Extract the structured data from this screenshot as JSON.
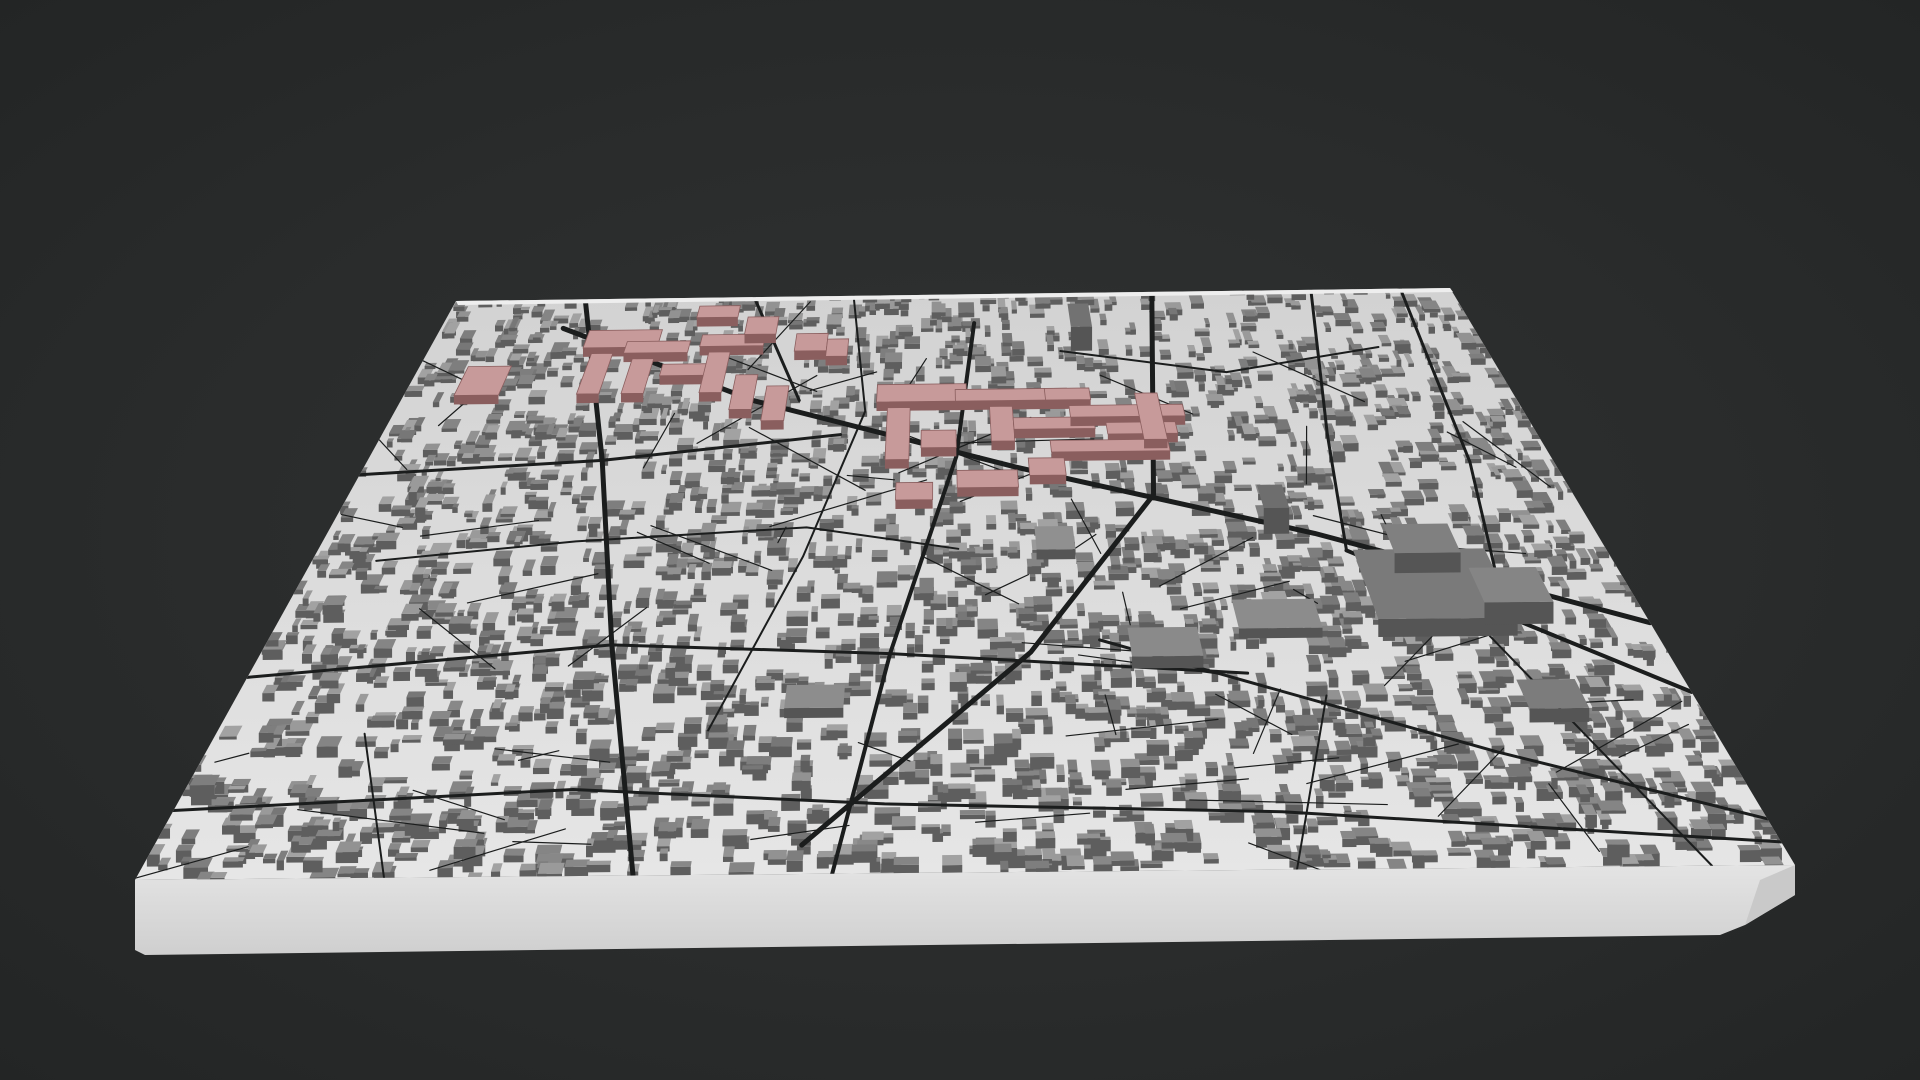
{
  "scene": {
    "description_free": true,
    "background_color": "#2a2c2c",
    "model_base_color": "#dcdcdc",
    "model_side_color": "#d2d2d2",
    "building_color": "#8a8a8a",
    "street_color": "#1b1d1d",
    "highlight_color": "#c79a9a",
    "highlight_edge_color": "#8a5e5e",
    "icons": [
      "city-model"
    ]
  }
}
